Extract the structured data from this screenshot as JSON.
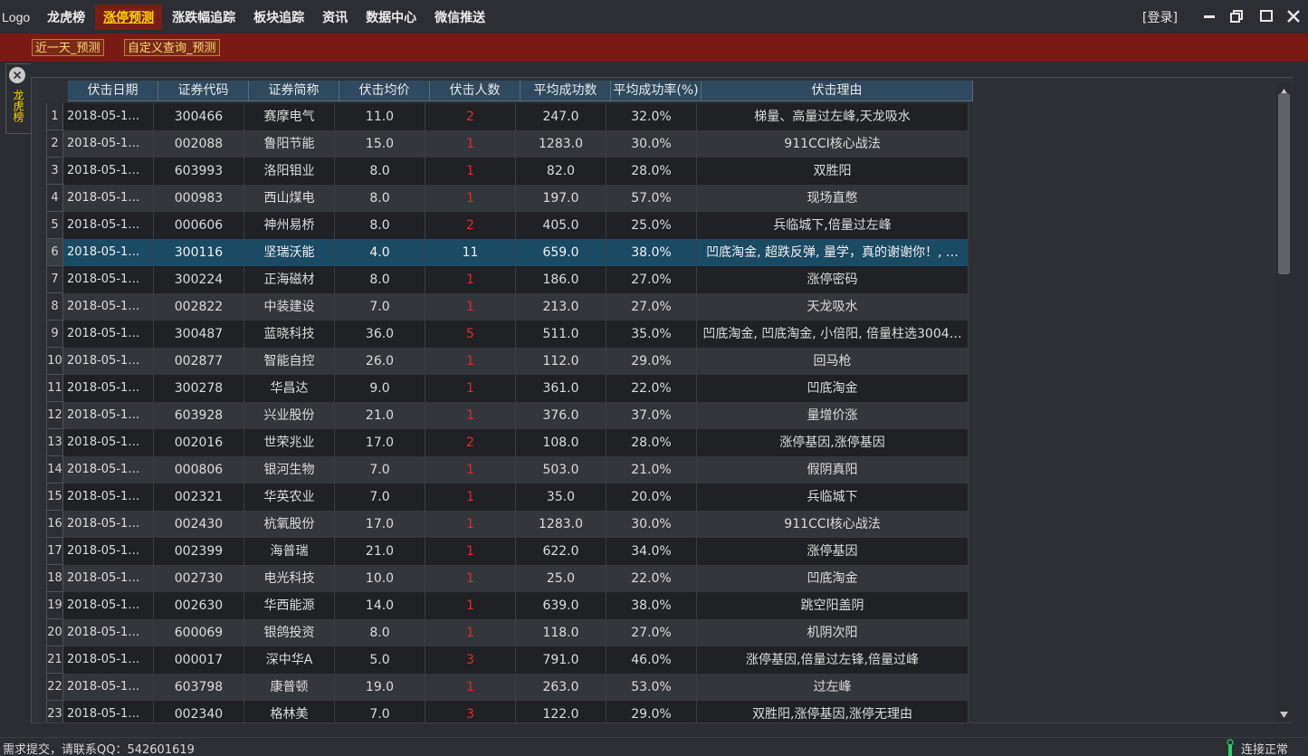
{
  "app": {
    "logo": "Logo",
    "menu": [
      "龙虎榜",
      "涨停预测",
      "涨跌幅追踪",
      "板块追踪",
      "资讯",
      "数据中心",
      "微信推送"
    ],
    "active_menu": "涨停预测",
    "login": "[登录]"
  },
  "toolbar": {
    "btn1": "近一天_预测",
    "btn2": "自定义查询_预测"
  },
  "side_tab": {
    "label": "龙虎榜"
  },
  "table": {
    "columns": [
      "伏击日期",
      "证券代码",
      "证券简称",
      "伏击均价",
      "伏击人数",
      "平均成功数",
      "平均成功率(%)",
      "伏击理由"
    ],
    "selected_row": 6,
    "rows": [
      {
        "n": "1",
        "date": "2018-05-1…",
        "code": "300466",
        "name": "赛摩电气",
        "price": "11.0",
        "count": "2",
        "avg": "247.0",
        "rate": "32.0%",
        "reason": "梯量、高量过左峰,天龙吸水"
      },
      {
        "n": "2",
        "date": "2018-05-1…",
        "code": "002088",
        "name": "鲁阳节能",
        "price": "15.0",
        "count": "1",
        "avg": "1283.0",
        "rate": "30.0%",
        "reason": "911CCI核心战法"
      },
      {
        "n": "3",
        "date": "2018-05-1…",
        "code": "603993",
        "name": "洛阳钼业",
        "price": "8.0",
        "count": "1",
        "avg": "82.0",
        "rate": "28.0%",
        "reason": "双胜阳"
      },
      {
        "n": "4",
        "date": "2018-05-1…",
        "code": "000983",
        "name": "西山煤电",
        "price": "8.0",
        "count": "1",
        "avg": "197.0",
        "rate": "57.0%",
        "reason": "现场直憋"
      },
      {
        "n": "5",
        "date": "2018-05-1…",
        "code": "000606",
        "name": "神州易桥",
        "price": "8.0",
        "count": "2",
        "avg": "405.0",
        "rate": "25.0%",
        "reason": "兵临城下,倍量过左峰"
      },
      {
        "n": "6",
        "date": "2018-05-1…",
        "code": "300116",
        "name": "坚瑞沃能",
        "price": "4.0",
        "count": "11",
        "avg": "659.0",
        "rate": "38.0%",
        "reason": "凹底淘金, 超跌反弹, 量学，真的谢谢你！, …"
      },
      {
        "n": "7",
        "date": "2018-05-1…",
        "code": "300224",
        "name": "正海磁材",
        "price": "8.0",
        "count": "1",
        "avg": "186.0",
        "rate": "27.0%",
        "reason": "涨停密码"
      },
      {
        "n": "8",
        "date": "2018-05-1…",
        "code": "002822",
        "name": "中装建设",
        "price": "7.0",
        "count": "1",
        "avg": "213.0",
        "rate": "27.0%",
        "reason": "天龙吸水"
      },
      {
        "n": "9",
        "date": "2018-05-1…",
        "code": "300487",
        "name": "蓝晓科技",
        "price": "36.0",
        "count": "5",
        "avg": "511.0",
        "rate": "35.0%",
        "reason": "凹底淘金, 凹底淘金, 小倍阳, 倍量柱选3004…"
      },
      {
        "n": "10",
        "date": "2018-05-1…",
        "code": "002877",
        "name": "智能自控",
        "price": "26.0",
        "count": "1",
        "avg": "112.0",
        "rate": "29.0%",
        "reason": "回马枪"
      },
      {
        "n": "11",
        "date": "2018-05-1…",
        "code": "300278",
        "name": "华昌达",
        "price": "9.0",
        "count": "1",
        "avg": "361.0",
        "rate": "22.0%",
        "reason": "凹底淘金"
      },
      {
        "n": "12",
        "date": "2018-05-1…",
        "code": "603928",
        "name": "兴业股份",
        "price": "21.0",
        "count": "1",
        "avg": "376.0",
        "rate": "37.0%",
        "reason": "量增价涨"
      },
      {
        "n": "13",
        "date": "2018-05-1…",
        "code": "002016",
        "name": "世荣兆业",
        "price": "17.0",
        "count": "2",
        "avg": "108.0",
        "rate": "28.0%",
        "reason": "涨停基因,涨停基因"
      },
      {
        "n": "14",
        "date": "2018-05-1…",
        "code": "000806",
        "name": "银河生物",
        "price": "7.0",
        "count": "1",
        "avg": "503.0",
        "rate": "21.0%",
        "reason": "假阴真阳"
      },
      {
        "n": "15",
        "date": "2018-05-1…",
        "code": "002321",
        "name": "华英农业",
        "price": "7.0",
        "count": "1",
        "avg": "35.0",
        "rate": "20.0%",
        "reason": "兵临城下"
      },
      {
        "n": "16",
        "date": "2018-05-1…",
        "code": "002430",
        "name": "杭氧股份",
        "price": "17.0",
        "count": "1",
        "avg": "1283.0",
        "rate": "30.0%",
        "reason": "911CCI核心战法"
      },
      {
        "n": "17",
        "date": "2018-05-1…",
        "code": "002399",
        "name": "海普瑞",
        "price": "21.0",
        "count": "1",
        "avg": "622.0",
        "rate": "34.0%",
        "reason": "涨停基因"
      },
      {
        "n": "18",
        "date": "2018-05-1…",
        "code": "002730",
        "name": "电光科技",
        "price": "10.0",
        "count": "1",
        "avg": "25.0",
        "rate": "22.0%",
        "reason": "凹底淘金"
      },
      {
        "n": "19",
        "date": "2018-05-1…",
        "code": "002630",
        "name": "华西能源",
        "price": "14.0",
        "count": "1",
        "avg": "639.0",
        "rate": "38.0%",
        "reason": "跳空阳盖阴"
      },
      {
        "n": "20",
        "date": "2018-05-1…",
        "code": "600069",
        "name": "银鸽投资",
        "price": "8.0",
        "count": "1",
        "avg": "118.0",
        "rate": "27.0%",
        "reason": "机阴次阳"
      },
      {
        "n": "21",
        "date": "2018-05-1…",
        "code": "000017",
        "name": "深中华A",
        "price": "5.0",
        "count": "3",
        "avg": "791.0",
        "rate": "46.0%",
        "reason": "涨停基因,倍量过左锋,倍量过峰"
      },
      {
        "n": "22",
        "date": "2018-05-1…",
        "code": "603798",
        "name": "康普顿",
        "price": "19.0",
        "count": "1",
        "avg": "263.0",
        "rate": "53.0%",
        "reason": "过左峰"
      },
      {
        "n": "23",
        "date": "2018-05-1…",
        "code": "002340",
        "name": "格林美",
        "price": "7.0",
        "count": "3",
        "avg": "122.0",
        "rate": "29.0%",
        "reason": "双胜阳,涨停基因,涨停无理由"
      }
    ]
  },
  "status": {
    "left": "需求提交，请联系QQ：542601619",
    "right": "连接正常"
  },
  "colors": {
    "accent_red": "#7a1a14",
    "active_menu_text": "#ffd200",
    "count_red": "#e02a2a",
    "selected_row": "#1a4a64",
    "header_bg": "#2f4a5e"
  }
}
